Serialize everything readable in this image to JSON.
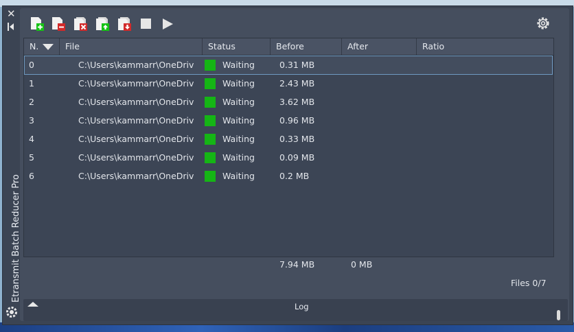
{
  "app": {
    "title": "Etransmit Batch Reducer Pro"
  },
  "toolbar": {
    "buttons": [
      {
        "name": "add-files-icon",
        "color": "#16c216"
      },
      {
        "name": "remove-file-icon",
        "color": "#d22a2a"
      },
      {
        "name": "clear-list-icon",
        "color": "#d22a2a"
      },
      {
        "name": "move-up-icon",
        "color": "#16c216"
      },
      {
        "name": "move-down-icon",
        "color": "#d22a2a"
      },
      {
        "name": "stop-icon"
      },
      {
        "name": "play-icon"
      }
    ]
  },
  "table": {
    "columns": [
      "N.",
      "File",
      "Status",
      "Before",
      "After",
      "Ratio"
    ],
    "rows": [
      {
        "n": "0",
        "file": "C:\\Users\\kammarr\\OneDriv",
        "status": "Waiting",
        "before": "0.31 MB",
        "after": "",
        "ratio": ""
      },
      {
        "n": "1",
        "file": "C:\\Users\\kammarr\\OneDriv",
        "status": "Waiting",
        "before": "2.43 MB",
        "after": "",
        "ratio": ""
      },
      {
        "n": "2",
        "file": "C:\\Users\\kammarr\\OneDriv",
        "status": "Waiting",
        "before": "3.62 MB",
        "after": "",
        "ratio": ""
      },
      {
        "n": "3",
        "file": "C:\\Users\\kammarr\\OneDriv",
        "status": "Waiting",
        "before": "0.96 MB",
        "after": "",
        "ratio": ""
      },
      {
        "n": "4",
        "file": "C:\\Users\\kammarr\\OneDriv",
        "status": "Waiting",
        "before": "0.33 MB",
        "after": "",
        "ratio": ""
      },
      {
        "n": "5",
        "file": "C:\\Users\\kammarr\\OneDriv",
        "status": "Waiting",
        "before": "0.09 MB",
        "after": "",
        "ratio": ""
      },
      {
        "n": "6",
        "file": "C:\\Users\\kammarr\\OneDriv",
        "status": "Waiting",
        "before": "0.2 MB",
        "after": "",
        "ratio": ""
      }
    ],
    "selected_row": 0,
    "status_color": "#15b515"
  },
  "totals": {
    "before": "7.94 MB",
    "after": "0 MB"
  },
  "files_count": "Files 0/7",
  "log": {
    "label": "Log"
  }
}
